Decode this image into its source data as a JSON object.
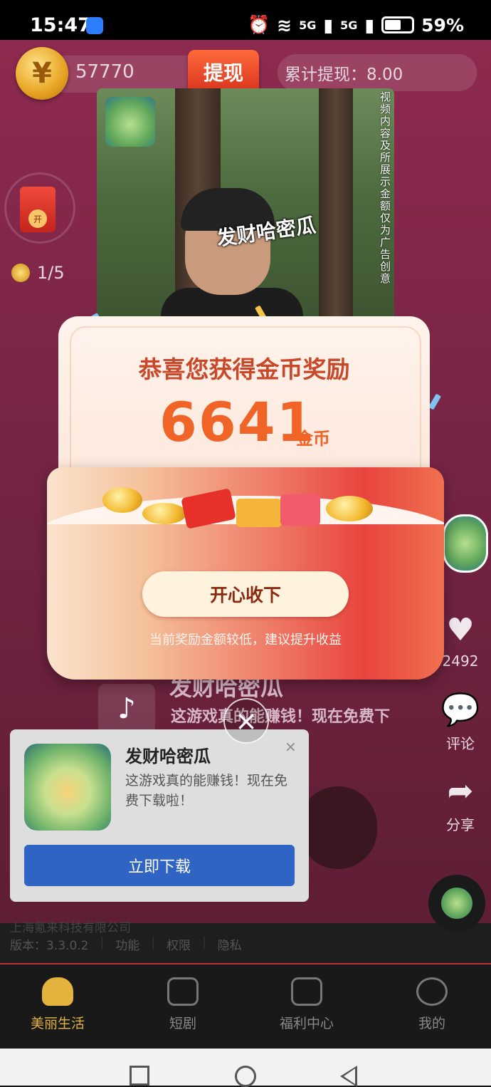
{
  "status_bar": {
    "time": "15:47",
    "network": "5G",
    "battery": "59%"
  },
  "top_bar": {
    "coin_balance": "57770",
    "withdraw_label": "提现",
    "total_withdrawn": "累计提现：8.00"
  },
  "task_progress": {
    "packet_label": "开",
    "progress_text": "1/5"
  },
  "video": {
    "caption": "发财哈密瓜",
    "disclaimer": "视频内容及所展示金额仅为广告创意"
  },
  "side_actions": {
    "likes": "2492",
    "comment_label": "评论",
    "share_label": "分享"
  },
  "ad_background": {
    "title": "发财哈密瓜",
    "desc": "这游戏真的能赚钱！现在免费下"
  },
  "ad_card": {
    "app_name": "发财哈密瓜",
    "desc": "这游戏真的能赚钱！现在免费下载啦！",
    "close": "×",
    "download_label": "立即下载"
  },
  "reward_modal": {
    "title": "恭喜您获得金币奖励",
    "amount": "6641",
    "unit": "金币",
    "accept_label": "开心收下",
    "tip": "当前奖励金额较低，建议提升收益",
    "close": "×"
  },
  "footer": {
    "company": "上海氪来科技有限公司",
    "version": "版本：3.3.0.2",
    "links": [
      "功能",
      "权限",
      "隐私"
    ]
  },
  "bottom_nav": {
    "tabs": [
      {
        "label": "美丽生活",
        "active": true
      },
      {
        "label": "短剧",
        "active": false
      },
      {
        "label": "福利中心",
        "active": false
      },
      {
        "label": "我的",
        "active": false
      }
    ]
  },
  "colors": {
    "accent": "#f06427",
    "nav_active": "#e3b33e",
    "download_button": "#2f63c4"
  }
}
